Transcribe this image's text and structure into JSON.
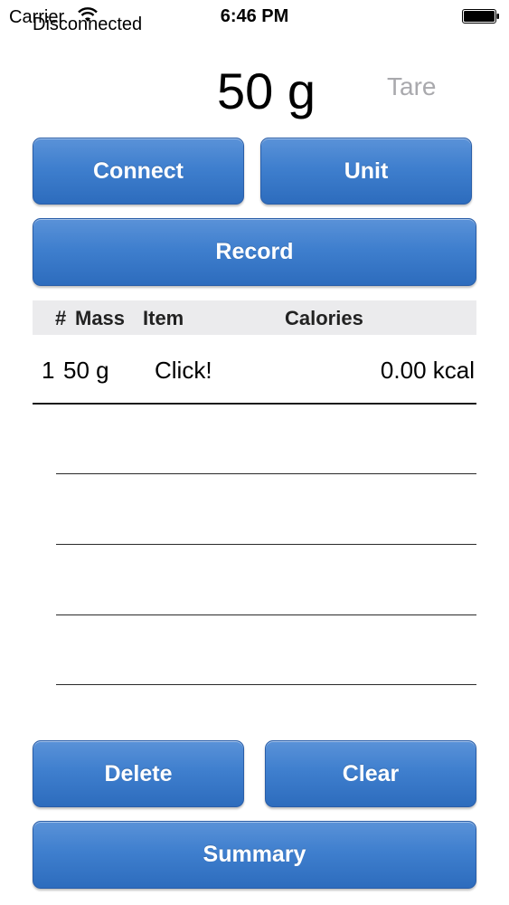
{
  "status_bar": {
    "carrier": "Carrier",
    "time": "6:46 PM"
  },
  "connection": {
    "status": "Disconnected"
  },
  "scale": {
    "weight": "50 g",
    "tare_label": "Tare"
  },
  "buttons": {
    "connect": "Connect",
    "unit": "Unit",
    "record": "Record",
    "delete": "Delete",
    "clear": "Clear",
    "summary": "Summary"
  },
  "table": {
    "headers": {
      "num": "#",
      "mass": "Mass",
      "item": "Item",
      "calories": "Calories"
    },
    "rows": [
      {
        "num": "1",
        "mass": "50 g",
        "item": "Click!",
        "calories": "0.00 kcal"
      }
    ]
  },
  "colors": {
    "button_blue": "#3f7fce",
    "header_bg": "#ebebed",
    "tare_gray": "#a9a9ad"
  }
}
